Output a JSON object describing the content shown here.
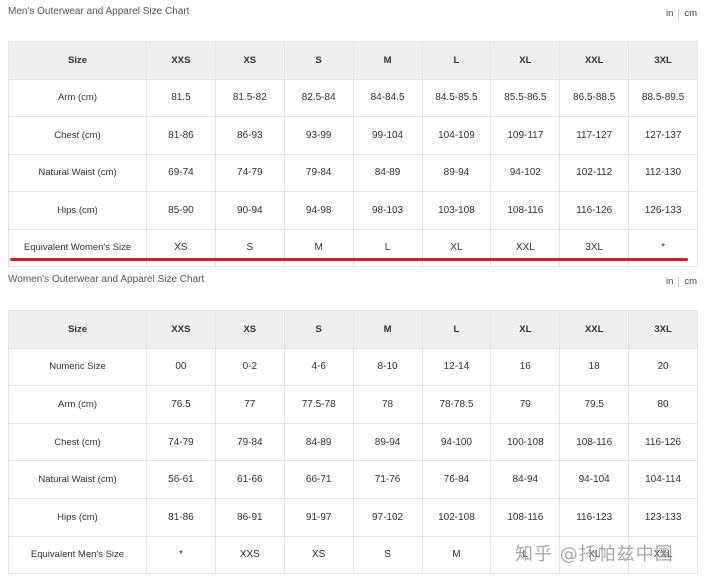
{
  "men": {
    "title": "Men's Outerwear and Apparel Size Chart",
    "units": [
      "in",
      "cm"
    ],
    "headers": [
      "Size",
      "XXS",
      "XS",
      "S",
      "M",
      "L",
      "XL",
      "XXL",
      "3XL"
    ],
    "rows": [
      [
        "Arm (cm)",
        "81.5",
        "81.5-82",
        "82.5-84",
        "84-84.5",
        "84.5-85.5",
        "85.5-86.5",
        "86.5-88.5",
        "88.5-89.5"
      ],
      [
        "Chest (cm)",
        "81-86",
        "86-93",
        "93-99",
        "99-104",
        "104-109",
        "109-117",
        "117-127",
        "127-137"
      ],
      [
        "Natural Waist (cm)",
        "69-74",
        "74-79",
        "79-84",
        "84-89",
        "89-94",
        "94-102",
        "102-112",
        "112-130"
      ],
      [
        "Hips (cm)",
        "85-90",
        "90-94",
        "94-98",
        "98-103",
        "103-108",
        "108-116",
        "116-126",
        "126-133"
      ],
      [
        "Equivalent Women's Size",
        "XS",
        "S",
        "M",
        "L",
        "XL",
        "XXL",
        "3XL",
        "*"
      ]
    ]
  },
  "women": {
    "title": "Women's Outerwear and Apparel Size Chart",
    "units": [
      "in",
      "cm"
    ],
    "headers": [
      "Size",
      "XXS",
      "XS",
      "S",
      "M",
      "L",
      "XL",
      "XXL",
      "3XL"
    ],
    "rows": [
      [
        "Numeric Size",
        "00",
        "0-2",
        "4-6",
        "8-10",
        "12-14",
        "16",
        "18",
        "20"
      ],
      [
        "Arm (cm)",
        "76.5",
        "77",
        "77.5-78",
        "78",
        "78-78.5",
        "79",
        "79.5",
        "80"
      ],
      [
        "Chest (cm)",
        "74-79",
        "79-84",
        "84-89",
        "89-94",
        "94-100",
        "100-108",
        "108-116",
        "116-126"
      ],
      [
        "Natural Waist (cm)",
        "56-61",
        "61-66",
        "66-71",
        "71-76",
        "76-84",
        "84-94",
        "94-104",
        "104-114"
      ],
      [
        "Hips (cm)",
        "81-86",
        "86-91",
        "91-97",
        "97-102",
        "102-108",
        "108-116",
        "116-123",
        "123-133"
      ],
      [
        "Equivalent Men's Size",
        "*",
        "XXS",
        "XS",
        "S",
        "M",
        "L",
        "XL",
        "XXL"
      ]
    ]
  },
  "watermark": "知乎 @托帕兹中国",
  "colors": {
    "header_bg": "#eeeeee",
    "highlight_underline": "#d42020",
    "border": "#e4e4e4"
  }
}
